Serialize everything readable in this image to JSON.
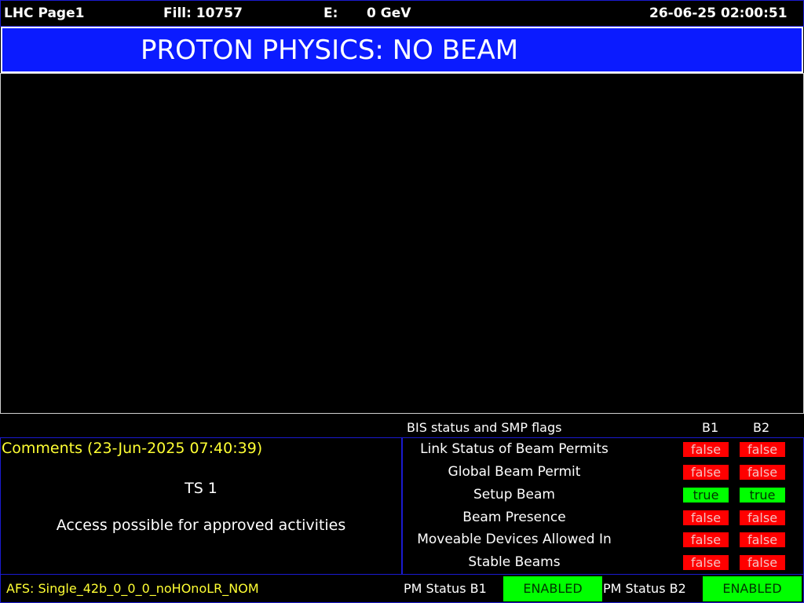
{
  "header": {
    "page": "LHC Page1",
    "fill": "Fill: 10757",
    "energy_label": "E:",
    "energy_value": "0 GeV",
    "datetime": "26-06-25 02:00:51"
  },
  "banner": {
    "text": "PROTON PHYSICS: NO BEAM",
    "color": "#0b1bff"
  },
  "bis": {
    "title": "BIS status and SMP flags",
    "col_b1": "B1",
    "col_b2": "B2",
    "rows": [
      {
        "label": "Link Status of Beam Permits",
        "b1": "false",
        "b2": "false"
      },
      {
        "label": "Global Beam Permit",
        "b1": "false",
        "b2": "false"
      },
      {
        "label": "Setup Beam",
        "b1": "true",
        "b2": "true"
      },
      {
        "label": "Beam Presence",
        "b1": "false",
        "b2": "false"
      },
      {
        "label": "Moveable Devices Allowed In",
        "b1": "false",
        "b2": "false"
      },
      {
        "label": "Stable Beams",
        "b1": "false",
        "b2": "false"
      }
    ]
  },
  "comments": {
    "title": "Comments (23-Jun-2025 07:40:39)",
    "line1": "TS 1",
    "line2": "Access possible for approved activities"
  },
  "footer": {
    "afs": "AFS: Single_42b_0_0_0_noHOnoLR_NOM",
    "pm_b1_label": "PM Status B1",
    "pm_b1_value": "ENABLED",
    "pm_b2_label": "PM Status B2",
    "pm_b2_value": "ENABLED"
  },
  "colors": {
    "false": "#ff0000",
    "true": "#00ff00",
    "comment_text": "#ffff33"
  }
}
